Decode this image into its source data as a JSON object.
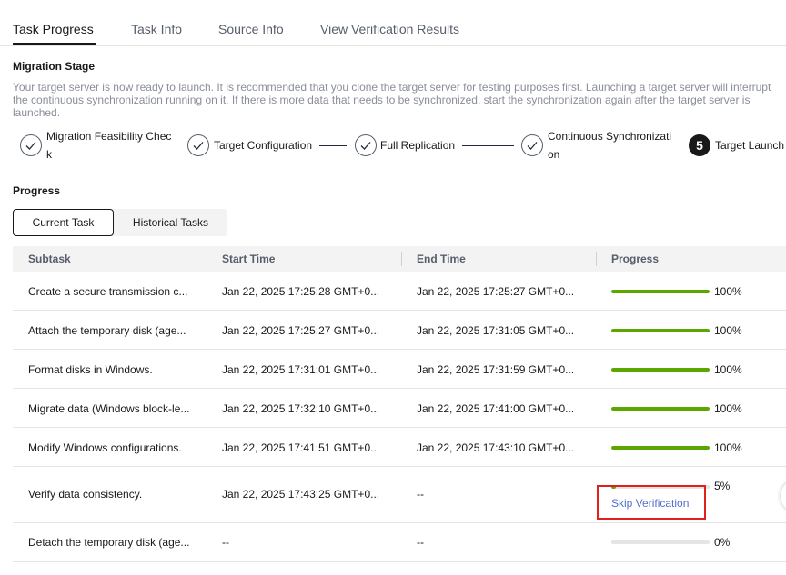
{
  "tabs": [
    {
      "label": "Task Progress",
      "active": true
    },
    {
      "label": "Task Info",
      "active": false
    },
    {
      "label": "Source Info",
      "active": false
    },
    {
      "label": "View Verification Results",
      "active": false
    }
  ],
  "stage": {
    "title": "Migration Stage",
    "description": "Your target server is now ready to launch. It is recommended that you clone the target server for testing purposes first. Launching a target server will interrupt the continuous synchronization running on it. If there is more data that needs to be synchronized, start the synchronization again after the target server is launched."
  },
  "steps": [
    {
      "label_line1": "Migration Feasibility Chec",
      "label_line2": "k",
      "status": "done"
    },
    {
      "label_line1": "Target Configuration",
      "label_line2": "",
      "status": "done"
    },
    {
      "label_line1": "Full Replication",
      "label_line2": "",
      "status": "done"
    },
    {
      "label_line1": "Continuous Synchronizati",
      "label_line2": "on",
      "status": "done"
    },
    {
      "number": "5",
      "label_line1": "Target Launch",
      "label_line2": "",
      "status": "current"
    }
  ],
  "progress": {
    "title": "Progress",
    "subtabs": [
      "Current Task",
      "Historical Tasks"
    ]
  },
  "table": {
    "headers": [
      "Subtask",
      "Start Time",
      "End Time",
      "Progress"
    ],
    "rows": [
      {
        "subtask": "Create a secure transmission c...",
        "start": "Jan 22, 2025 17:25:28 GMT+0...",
        "end": "Jan 22, 2025 17:25:27 GMT+0...",
        "progress": 100,
        "progress_label": "100%"
      },
      {
        "subtask": "Attach the temporary disk (age...",
        "start": "Jan 22, 2025 17:25:27 GMT+0...",
        "end": "Jan 22, 2025 17:31:05 GMT+0...",
        "progress": 100,
        "progress_label": "100%"
      },
      {
        "subtask": "Format disks in Windows.",
        "start": "Jan 22, 2025 17:31:01 GMT+0...",
        "end": "Jan 22, 2025 17:31:59 GMT+0...",
        "progress": 100,
        "progress_label": "100%"
      },
      {
        "subtask": "Migrate data (Windows block-le...",
        "start": "Jan 22, 2025 17:32:10 GMT+0...",
        "end": "Jan 22, 2025 17:41:00 GMT+0...",
        "progress": 100,
        "progress_label": "100%"
      },
      {
        "subtask": "Modify Windows configurations.",
        "start": "Jan 22, 2025 17:41:51 GMT+0...",
        "end": "Jan 22, 2025 17:43:10 GMT+0...",
        "progress": 100,
        "progress_label": "100%"
      },
      {
        "subtask": "Verify data consistency.",
        "start": "Jan 22, 2025 17:43:25 GMT+0...",
        "end": "--",
        "progress": 5,
        "progress_label": "5%",
        "action": "Skip Verification"
      },
      {
        "subtask": "Detach the temporary disk (age...",
        "start": "--",
        "end": "--",
        "progress": 0,
        "progress_label": "0%"
      }
    ]
  },
  "colors": {
    "progress_fill": "#5aa700",
    "link": "#526ecc",
    "highlight": "#e0201c"
  }
}
